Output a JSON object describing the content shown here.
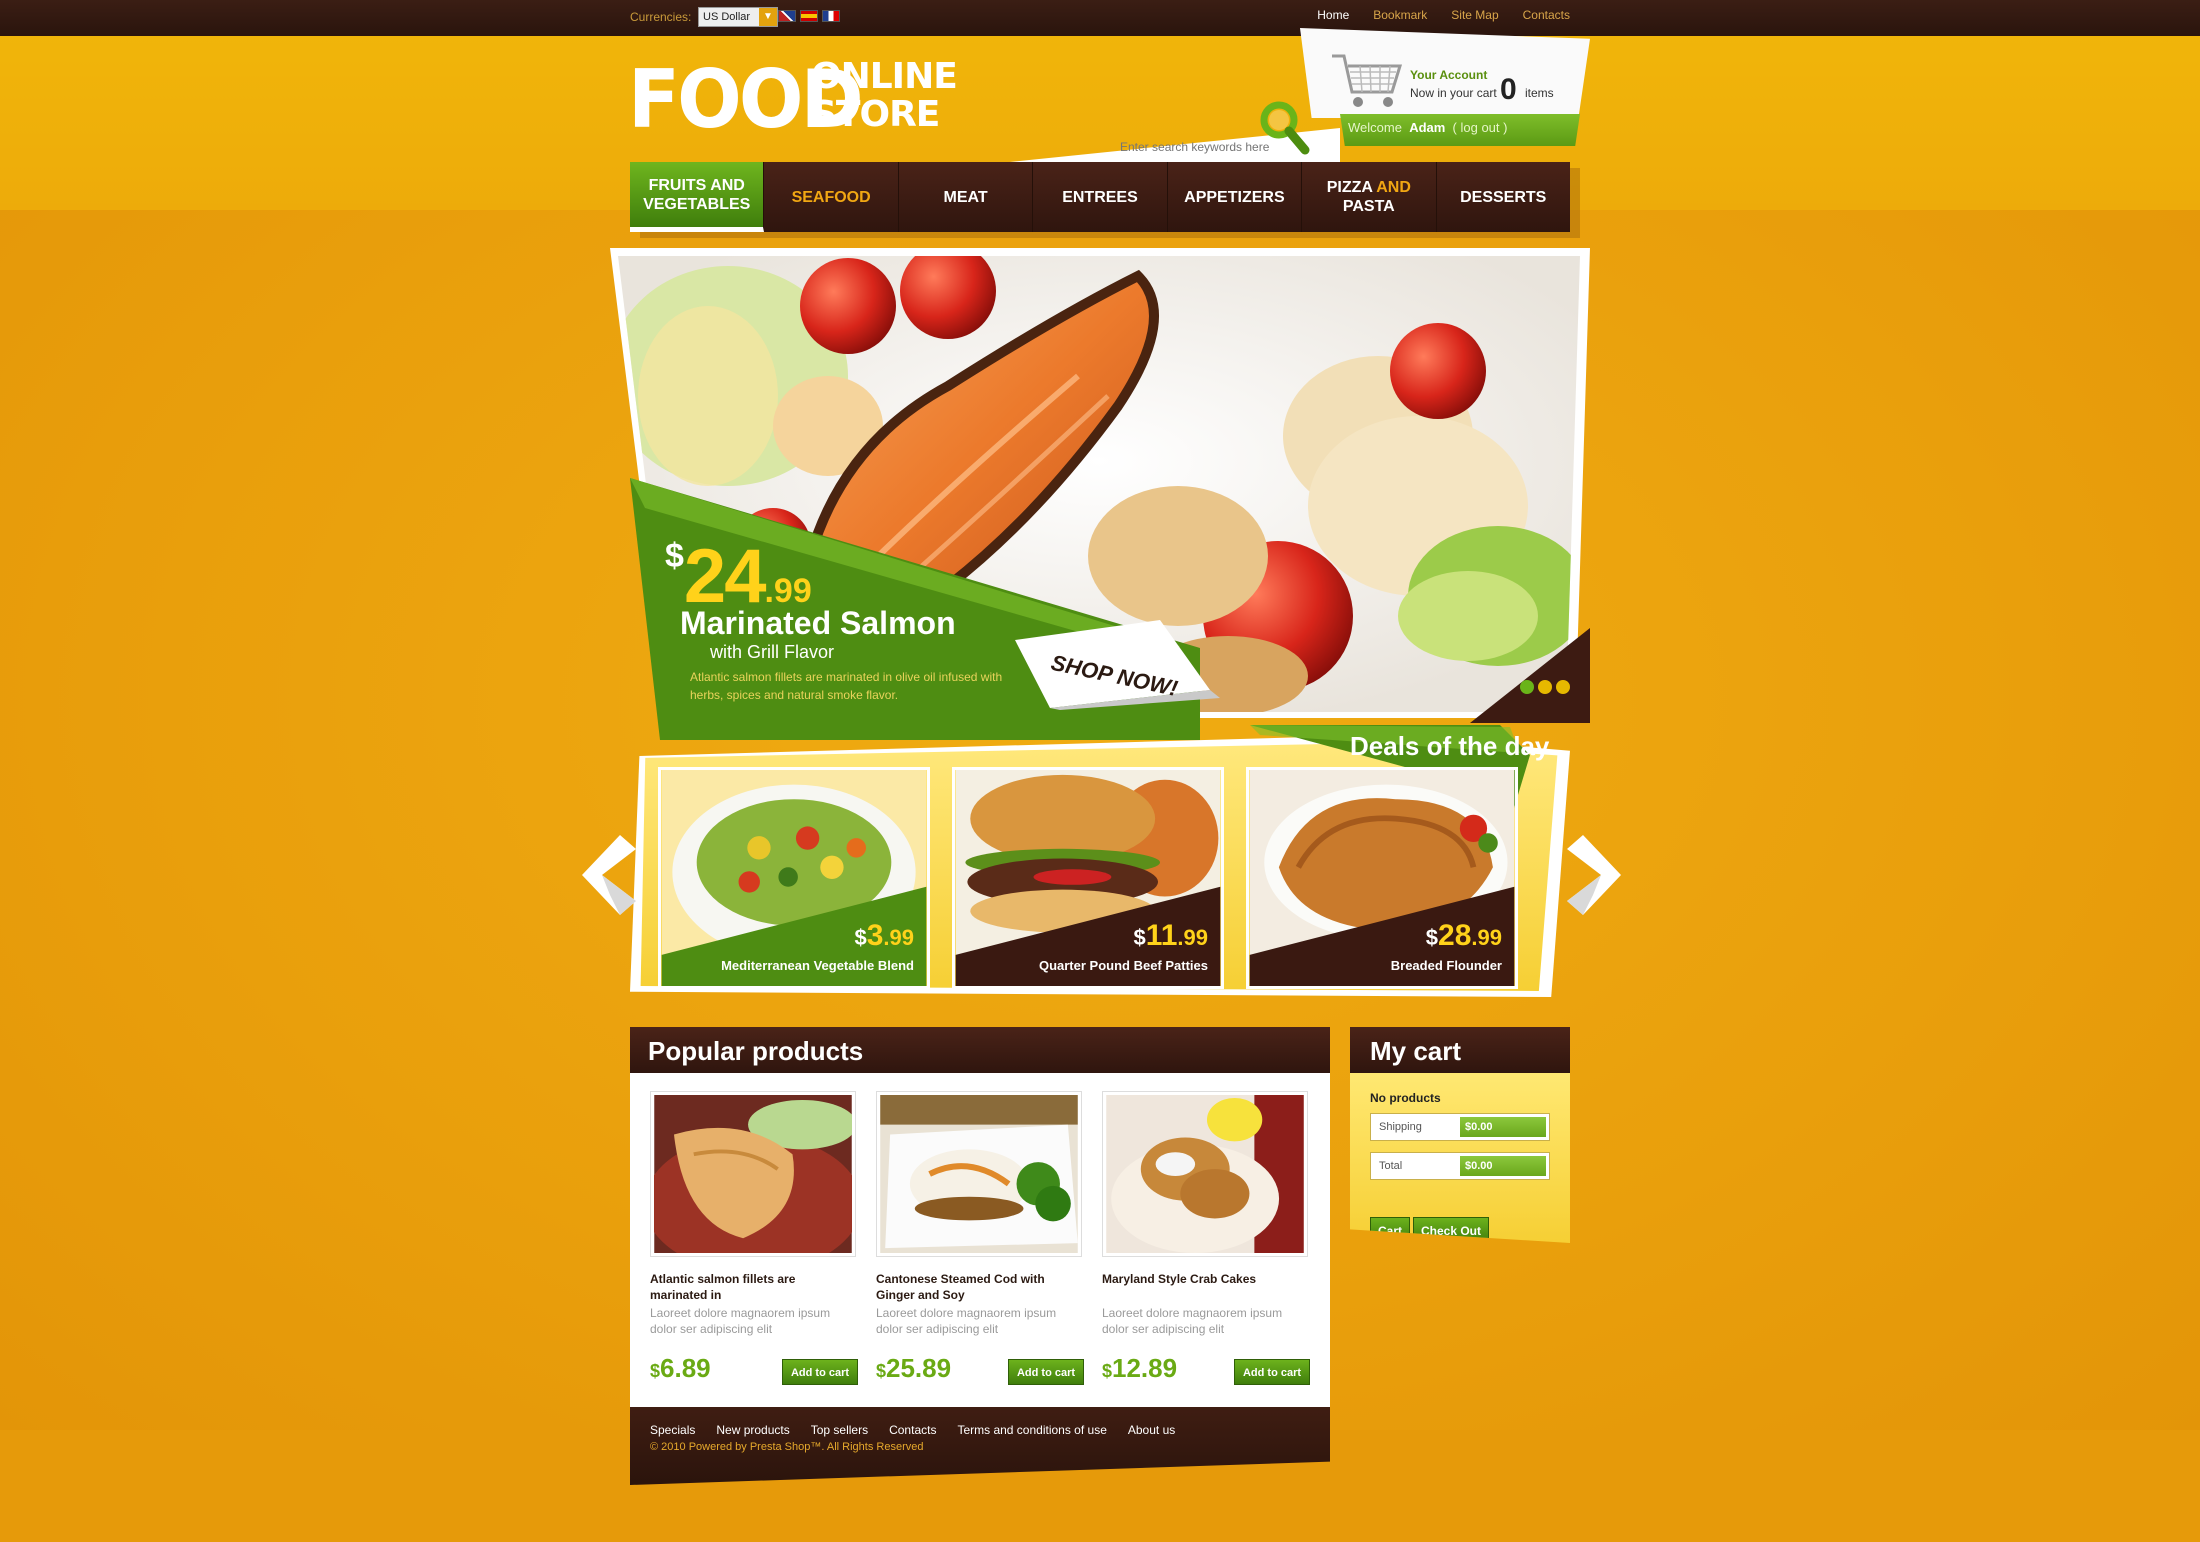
{
  "topbar": {
    "currencies_label": "Currencies:",
    "currency_value": "US Dollar",
    "links": [
      "Home",
      "Bookmark",
      "Site Map",
      "Contacts"
    ]
  },
  "logo": {
    "word1": "FOOD",
    "word2": "ONLINE",
    "word3": "STORE"
  },
  "search": {
    "placeholder": "Enter search keywords here"
  },
  "account": {
    "title": "Your Account",
    "cart_text": "Now in your cart",
    "cart_count": "0",
    "items_text": "items",
    "welcome": "Welcome",
    "user": "Adam",
    "logout": "( log out )"
  },
  "nav": {
    "items": [
      {
        "label": "FRUITS AND VEGETABLES"
      },
      {
        "label": "SEAFOOD"
      },
      {
        "label": "MEAT"
      },
      {
        "label": "ENTREES"
      },
      {
        "label": "APPETIZERS"
      },
      {
        "label_a": "PIZZA",
        "label_b": "AND",
        "label_c": "PASTA"
      },
      {
        "label": "DESSERTS"
      }
    ]
  },
  "hero": {
    "currency": "$",
    "price_whole": "24",
    "price_cents": ".99",
    "name": "Marinated Salmon",
    "sub": "with Grill Flavor",
    "desc": "Atlantic salmon fillets are marinated in olive oil infused with herbs, spices and natural smoke flavor.",
    "cta": "SHOP NOW!"
  },
  "deals": {
    "title": "Deals of the day",
    "items": [
      {
        "currency": "$",
        "whole": "3",
        "cents": ".99",
        "name": "Mediterranean Vegetable Blend"
      },
      {
        "currency": "$",
        "whole": "11",
        "cents": ".99",
        "name": "Quarter Pound Beef Patties"
      },
      {
        "currency": "$",
        "whole": "28",
        "cents": ".99",
        "name": "Breaded Flounder"
      }
    ]
  },
  "popular": {
    "title": "Popular products",
    "add_label": "Add to cart",
    "products": [
      {
        "name": "Atlantic salmon fillets are marinated in",
        "desc": "Laoreet dolore magnaorem ipsum dolor ser adipiscing elit",
        "currency": "$",
        "price": "6.89"
      },
      {
        "name": "Cantonese Steamed Cod with Ginger and Soy",
        "desc": "Laoreet dolore magnaorem ipsum dolor ser adipiscing elit",
        "currency": "$",
        "price": "25.89"
      },
      {
        "name": "Maryland Style Crab Cakes",
        "desc": "Laoreet dolore magnaorem ipsum dolor ser adipiscing elit",
        "currency": "$",
        "price": "12.89"
      }
    ]
  },
  "footer": {
    "links": [
      "Specials",
      "New products",
      "Top sellers",
      "Contacts",
      "Terms and conditions of use",
      "About us"
    ],
    "copyright": "© 2010 Powered by Presta Shop™. All Rights Reserved"
  },
  "mycart": {
    "title": "My cart",
    "no_products": "No products",
    "shipping_label": "Shipping",
    "shipping_value": "$0.00",
    "total_label": "Total",
    "total_value": "$0.00",
    "cart_btn": "Cart",
    "checkout_btn": "Check Out"
  },
  "colors": {
    "background": "#eca40c",
    "dark_brown": "#2f150e",
    "green": "#5b9a14",
    "accent_orange": "#f1a713",
    "price_yellow": "#ffd21a"
  }
}
